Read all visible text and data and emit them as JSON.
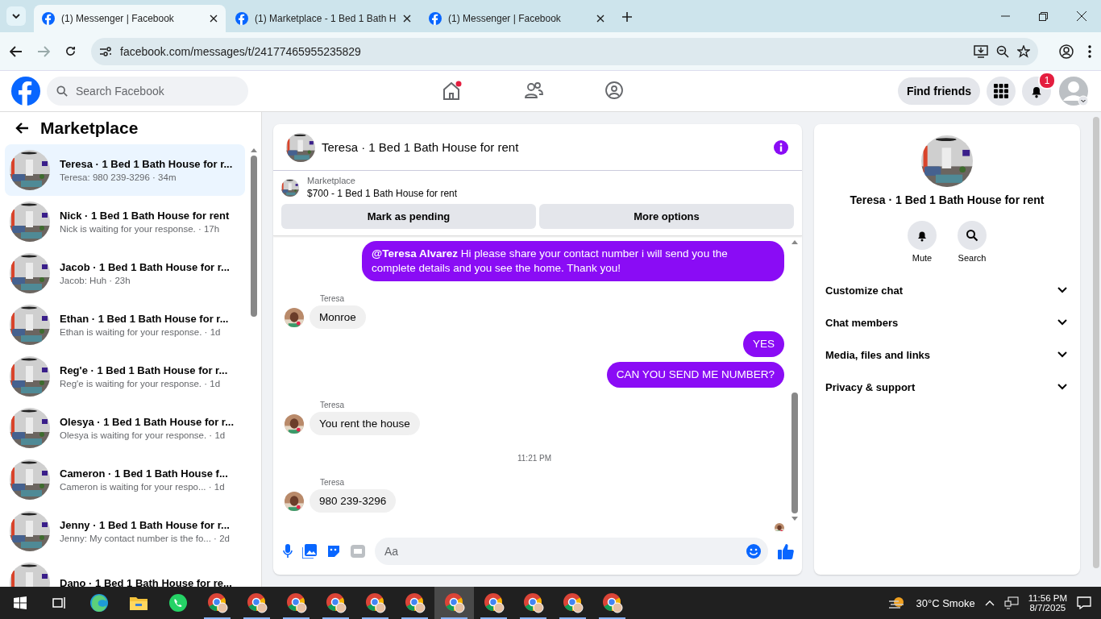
{
  "browser": {
    "tabs": [
      {
        "title": "(1) Messenger | Facebook",
        "selected": true
      },
      {
        "title": "(1) Marketplace - 1 Bed 1 Bath H",
        "selected": false
      },
      {
        "title": "(1) Messenger | Facebook",
        "selected": false
      }
    ],
    "url": "facebook.com/messages/t/24177465955235829"
  },
  "topbar": {
    "search_placeholder": "Search Facebook",
    "find_friends": "Find friends",
    "notification_count": "1"
  },
  "sidebar": {
    "title": "Marketplace",
    "conversations": [
      {
        "title": "Teresa · 1 Bed 1 Bath House for r...",
        "preview": "Teresa: 980 239-3296 · 34m",
        "selected": true
      },
      {
        "title": "Nick · 1 Bed 1 Bath House for rent",
        "preview": "Nick is waiting for your response. · 17h",
        "selected": false
      },
      {
        "title": "Jacob · 1 Bed 1 Bath House for r...",
        "preview": "Jacob: Huh · 23h",
        "selected": false
      },
      {
        "title": "Ethan · 1 Bed 1 Bath House for r...",
        "preview": "Ethan is waiting for your response. · 1d",
        "selected": false
      },
      {
        "title": "Reg'e · 1 Bed 1 Bath House for r...",
        "preview": "Reg'e is waiting for your response. · 1d",
        "selected": false
      },
      {
        "title": "Olesya · 1 Bed 1 Bath House for r...",
        "preview": "Olesya is waiting for your response. · 1d",
        "selected": false
      },
      {
        "title": "Cameron · 1 Bed 1 Bath House f...",
        "preview": "Cameron is waiting for your respo...  · 1d",
        "selected": false
      },
      {
        "title": "Jenny · 1 Bed 1 Bath House for r...",
        "preview": "Jenny: My contact number is the fo... · 2d",
        "selected": false
      },
      {
        "title": "Dano · 1 Bed 1 Bath House for re...",
        "selected": false
      }
    ]
  },
  "chat": {
    "title": "Teresa · 1 Bed 1 Bath House for rent",
    "listing": {
      "label": "Marketplace",
      "title": "$700 - 1 Bed 1 Bath House for rent"
    },
    "buttons": [
      "Mark as pending",
      "More options"
    ],
    "messages": [
      {
        "kind": "outgoing",
        "text": "**@Teresa Alvarez** Hi please share your contact number i will send you the complete details and you see the home. Thank you!"
      },
      {
        "kind": "incoming",
        "sender": "Teresa",
        "text": "Monroe"
      },
      {
        "kind": "outgoing",
        "text": "YES"
      },
      {
        "kind": "outgoing",
        "text": "CAN YOU SEND ME NUMBER?"
      },
      {
        "kind": "incoming",
        "sender": "Teresa",
        "text": "You rent the house"
      },
      {
        "kind": "timestamp",
        "text": "11:21 PM"
      },
      {
        "kind": "incoming",
        "sender": "Teresa",
        "text": "980 239-3296"
      }
    ],
    "composer_placeholder": "Aa"
  },
  "details": {
    "title": "Teresa · 1 Bed 1 Bath House for rent",
    "actions": [
      {
        "kind": "mute",
        "label": "Mute"
      },
      {
        "kind": "search",
        "label": "Search"
      }
    ],
    "sections": [
      {
        "label": "Customize chat",
        "expanded": false
      },
      {
        "label": "Chat members",
        "expanded": false
      },
      {
        "label": "Media, files and links",
        "expanded": false
      },
      {
        "label": "Privacy & support",
        "expanded": false
      }
    ]
  },
  "taskbar": {
    "apps": [
      {
        "kind": "taskview",
        "selected": false
      },
      {
        "kind": "edge",
        "selected": false
      },
      {
        "kind": "files",
        "selected": false
      },
      {
        "kind": "whatsapp",
        "selected": false
      },
      {
        "kind": "chrome",
        "selected": false
      },
      {
        "kind": "chrome",
        "selected": false
      },
      {
        "kind": "chrome",
        "selected": false
      },
      {
        "kind": "chrome",
        "selected": false
      },
      {
        "kind": "chrome",
        "selected": false
      },
      {
        "kind": "chrome",
        "selected": false
      },
      {
        "kind": "chrome",
        "selected": true
      },
      {
        "kind": "chrome",
        "selected": false
      },
      {
        "kind": "chrome",
        "selected": false
      },
      {
        "kind": "chrome",
        "selected": false
      },
      {
        "kind": "chrome",
        "selected": false
      }
    ],
    "weather": "30°C  Smoke",
    "time": "11:56 PM",
    "date": "8/7/2025"
  }
}
